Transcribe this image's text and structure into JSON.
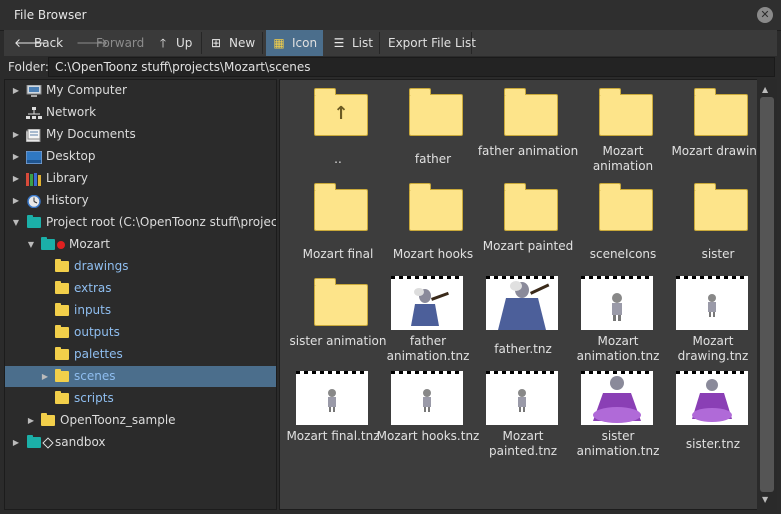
{
  "window": {
    "title": "File Browser",
    "close_glyph": "✕"
  },
  "toolbar": {
    "back": "Back",
    "forward": "Forward",
    "up": "Up",
    "new": "New",
    "icon": "Icon",
    "list": "List",
    "export": "Export File List"
  },
  "folder": {
    "label": "Folder:",
    "path": "C:\\OpenToonz stuff\\projects\\Mozart\\scenes"
  },
  "tree": [
    {
      "label": "My Computer",
      "icon": "computer-icon"
    },
    {
      "label": "Network",
      "icon": "network-icon"
    },
    {
      "label": "My Documents",
      "icon": "documents-icon"
    },
    {
      "label": "Desktop",
      "icon": "desktop-icon"
    },
    {
      "label": "Library",
      "icon": "library-icon"
    },
    {
      "label": "History",
      "icon": "history-icon"
    },
    {
      "label": "Project root (C:\\OpenToonz stuff\\projects)",
      "icon": "project-root-icon"
    },
    {
      "label": "Mozart",
      "icon": "project-folder-icon"
    },
    {
      "label": "drawings",
      "icon": "folder-icon"
    },
    {
      "label": "extras",
      "icon": "folder-icon"
    },
    {
      "label": "inputs",
      "icon": "folder-icon"
    },
    {
      "label": "outputs",
      "icon": "folder-icon"
    },
    {
      "label": "palettes",
      "icon": "folder-icon"
    },
    {
      "label": "scenes",
      "icon": "folder-icon"
    },
    {
      "label": "scripts",
      "icon": "folder-icon"
    },
    {
      "label": "OpenToonz_sample",
      "icon": "folder-icon"
    },
    {
      "label": "sandbox",
      "icon": "project-folder-icon"
    }
  ],
  "items": [
    {
      "label": "..",
      "kind": "parent-folder"
    },
    {
      "label": "father",
      "kind": "folder"
    },
    {
      "label": "father animation",
      "kind": "folder"
    },
    {
      "label": "Mozart animation",
      "kind": "folder"
    },
    {
      "label": "Mozart drawing",
      "kind": "folder"
    },
    {
      "label": "Mozart final",
      "kind": "folder"
    },
    {
      "label": "Mozart hooks",
      "kind": "folder"
    },
    {
      "label": "Mozart painted",
      "kind": "folder"
    },
    {
      "label": "sceneIcons",
      "kind": "folder"
    },
    {
      "label": "sister",
      "kind": "folder"
    },
    {
      "label": "sister animation",
      "kind": "folder"
    },
    {
      "label": "father animation.tnz",
      "kind": "scene"
    },
    {
      "label": "father.tnz",
      "kind": "scene"
    },
    {
      "label": "Mozart animation.tnz",
      "kind": "scene"
    },
    {
      "label": "Mozart drawing.tnz",
      "kind": "scene"
    },
    {
      "label": "Mozart final.tnz",
      "kind": "scene"
    },
    {
      "label": "Mozart hooks.tnz",
      "kind": "scene"
    },
    {
      "label": "Mozart painted.tnz",
      "kind": "scene"
    },
    {
      "label": "sister animation.tnz",
      "kind": "scene"
    },
    {
      "label": "sister.tnz",
      "kind": "scene"
    }
  ],
  "colors": {
    "selection": "#4b6e8c",
    "folder": "#fde48a",
    "tree_folder": "#f2cf4a",
    "teal_folder": "#1bb0a8",
    "link_text": "#8fbef0"
  }
}
